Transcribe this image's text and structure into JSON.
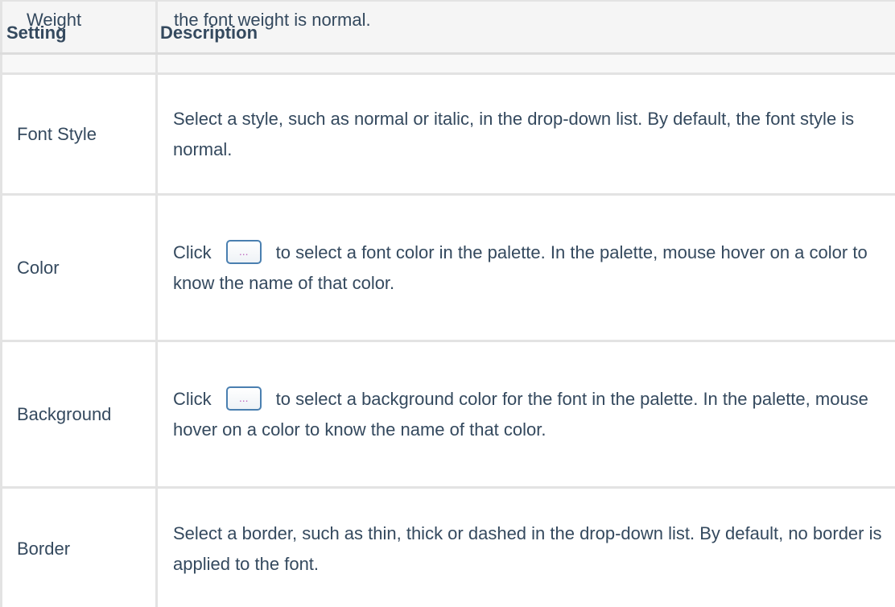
{
  "header": {
    "setting_label": "Setting",
    "description_label": "Description",
    "overlap_setting": "Weight",
    "overlap_description": "the font weight is normal."
  },
  "rows": [
    {
      "setting": "Font Style",
      "description": "Select a style, such as normal or italic, in the drop-down list. By default, the font style is normal."
    },
    {
      "setting": "Color",
      "description_before": "Click",
      "button_label": "...",
      "description_after": "to select a font color in the palette. In the palette, mouse hover on a color to know the name of that color."
    },
    {
      "setting": "Background",
      "description_before": "Click",
      "button_label": "...",
      "description_after": "to select a background color for the font in the palette. In the palette, mouse hover on a color to know the name of that color."
    },
    {
      "setting": "Border",
      "description": "Select a border, such as thin, thick or dashed in the drop-down list. By default, no border is applied to the font."
    }
  ],
  "colors": {
    "border": "#e3e3e3",
    "text": "#34495e",
    "header_bg": "#f5f5f5",
    "button_border": "#4a7fb0",
    "button_text": "#c06bc0"
  }
}
